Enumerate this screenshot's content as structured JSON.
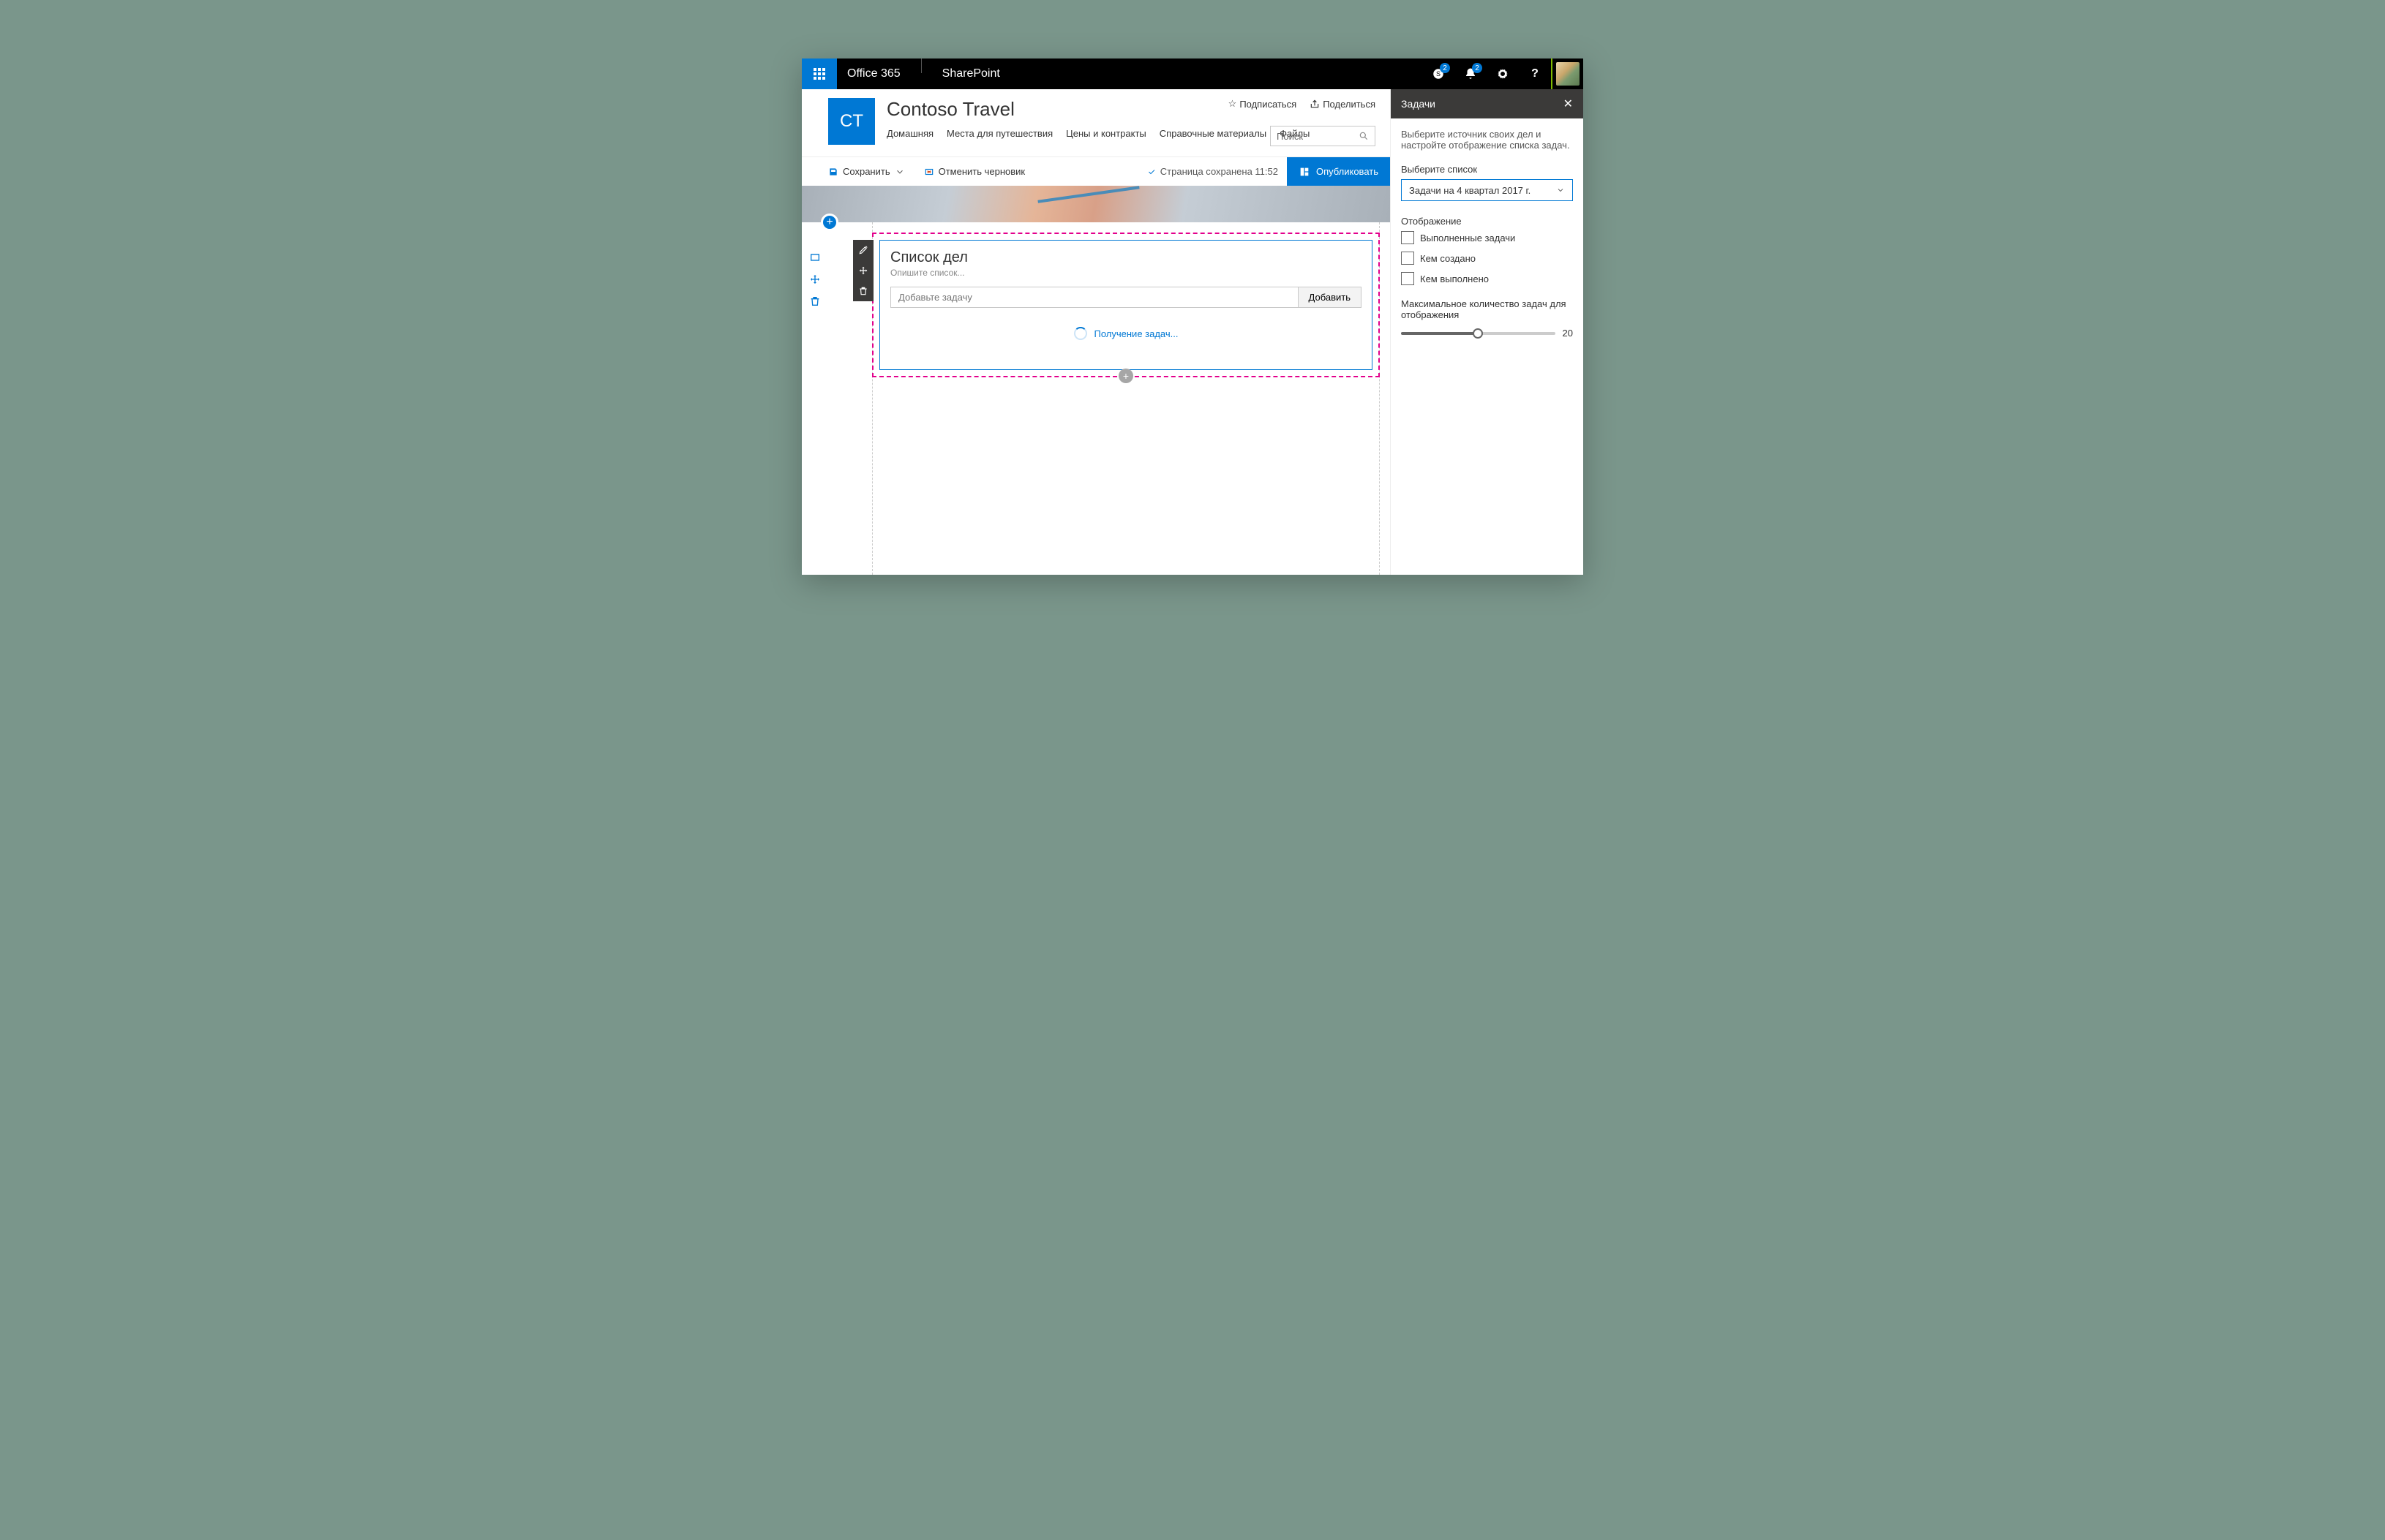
{
  "topbar": {
    "office": "Office 365",
    "app": "SharePoint",
    "badge1": "2",
    "badge2": "2"
  },
  "site": {
    "logo": "CT",
    "title": "Contoso Travel",
    "nav": [
      "Домашняя",
      "Места для путешествия",
      "Цены и контракты",
      "Справочные материалы",
      "Файлы"
    ],
    "follow": "Подписаться",
    "share": "Поделиться",
    "search_placeholder": "Поиск"
  },
  "cmd": {
    "save": "Сохранить",
    "discard": "Отменить черновик",
    "status": "Страница сохранена 11:52",
    "publish": "Опубликовать"
  },
  "webpart": {
    "title": "Список дел",
    "subtitle": "Опишите список...",
    "input_placeholder": "Добавьте задачу",
    "add_btn": "Добавить",
    "loading": "Получение задач..."
  },
  "pane": {
    "title": "Задачи",
    "desc": "Выберите источник своих дел и настройте отображение списка задач.",
    "list_label": "Выберите список",
    "list_value": "Задачи на 4 квартал 2017 г.",
    "display_label": "Отображение",
    "checks": [
      "Выполненные задачи",
      "Кем создано",
      "Кем выполнено"
    ],
    "slider_label": "Максимальное количество задач для отображения",
    "slider_value": "20"
  }
}
